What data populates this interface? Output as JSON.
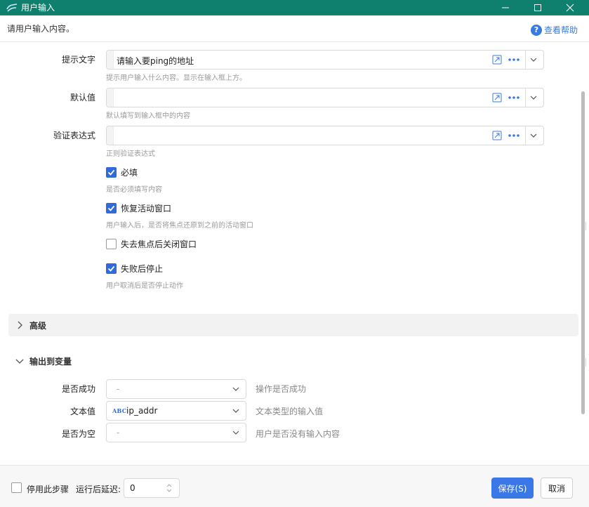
{
  "window": {
    "title": "用户输入",
    "controls": [
      "minimize-icon",
      "maximize-icon",
      "close-icon"
    ]
  },
  "header": {
    "description": "请用户输入内容。",
    "help_label": "查看帮助"
  },
  "fields": {
    "prompt": {
      "label": "提示文字",
      "value": "请输入要ping的地址",
      "hint": "提示用户输入什么内容。显示在输入框上方。"
    },
    "default": {
      "label": "默认值",
      "value": "",
      "hint": "默认填写到输入框中的内容"
    },
    "regex": {
      "label": "验证表达式",
      "value": "",
      "hint": "正则验证表达式"
    }
  },
  "options": {
    "required": {
      "label": "必填",
      "checked": true,
      "hint": "是否必须填写内容"
    },
    "restore_window": {
      "label": "恢复活动窗口",
      "checked": true,
      "hint": "用户输入后，是否将焦点还原到之前的活动窗口"
    },
    "close_on_blur": {
      "label": "失去焦点后关闭窗口",
      "checked": false,
      "hint": ""
    },
    "stop_on_fail": {
      "label": "失败后停止",
      "checked": true,
      "hint": "用户取消后是否停止动作"
    }
  },
  "advanced": {
    "title": "高级",
    "expanded": false
  },
  "output": {
    "title": "输出到变量",
    "expanded": true,
    "rows": [
      {
        "label": "是否成功",
        "value": "-",
        "desc": "操作是否成功"
      },
      {
        "label": "文本值",
        "type_badge": "ABC",
        "value": "ip_addr",
        "desc": "文本类型的输入值"
      },
      {
        "label": "是否为空",
        "value": "-",
        "desc": "用户是否没有输入内容"
      }
    ]
  },
  "footer": {
    "disable_label": "停用此步骤",
    "disable_checked": false,
    "delay_label": "运行后延迟:",
    "delay_value": "0",
    "save_label": "保存(S)",
    "cancel_label": "取消"
  },
  "colors": {
    "titlebar": "#0f7f6e",
    "accent": "#3b78e7",
    "checkbox": "#2f6bdb"
  }
}
